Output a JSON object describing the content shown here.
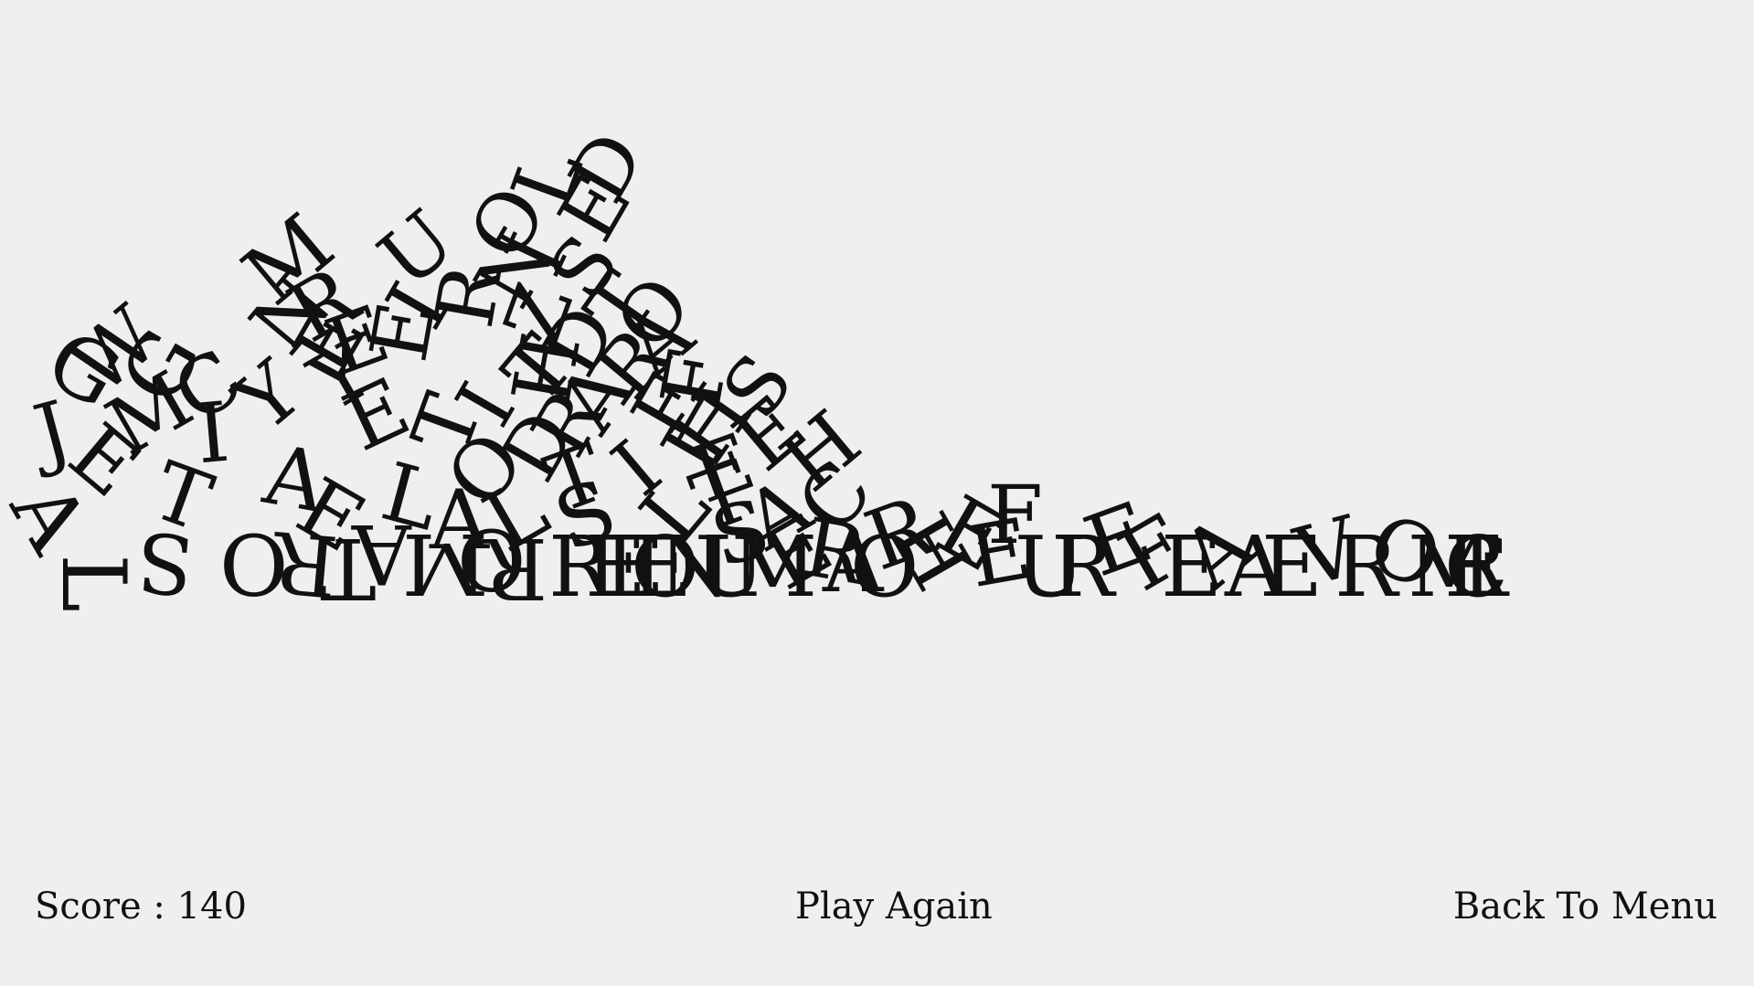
{
  "hud": {
    "score_label": "Score :",
    "score_value": "140",
    "play_again_label": "Play Again",
    "back_to_menu_label": "Back To Menu"
  },
  "letters": [
    "L",
    "A",
    "E",
    "J",
    "G",
    "W",
    "G",
    "M",
    "S",
    "T",
    "I",
    "C",
    "O",
    "R",
    "A",
    "Y",
    "E",
    "T",
    "E",
    "A",
    "Y",
    "N",
    "L",
    "M",
    "A",
    "O",
    "O",
    "R",
    "T",
    "I",
    "L",
    "D",
    "R",
    "E",
    "S",
    "T",
    "E",
    "E",
    "L",
    "T",
    "R",
    "R",
    "M",
    "E",
    "E",
    "E",
    "I",
    "U",
    "R",
    "N",
    "Z",
    "H",
    "D",
    "A",
    "R",
    "E",
    "I",
    "T",
    "I",
    "O",
    "S",
    "T",
    "A",
    "F",
    "E",
    "L",
    "D",
    "I",
    "O",
    "H",
    "S",
    "E",
    "H",
    "C",
    "A",
    "E",
    "S",
    "O",
    "N",
    "U",
    "M",
    "E",
    "R",
    "A",
    "O",
    "R",
    "H",
    "E",
    "E",
    "F",
    "U",
    "R",
    "E",
    "F",
    "E",
    "A",
    "A",
    "E",
    "V",
    "R",
    "O",
    "M",
    "E",
    "R",
    "C"
  ]
}
